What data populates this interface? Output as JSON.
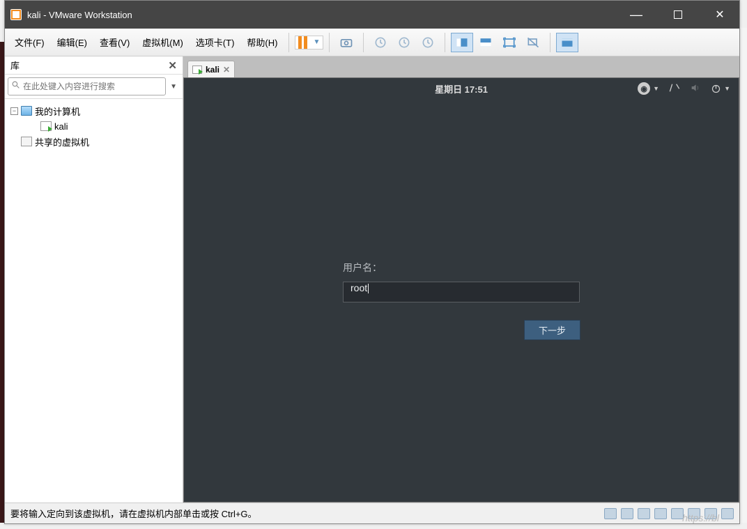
{
  "window": {
    "title": "kali - VMware Workstation"
  },
  "menu": {
    "items": [
      "文件(F)",
      "编辑(E)",
      "查看(V)",
      "虚拟机(M)",
      "选项卡(T)",
      "帮助(H)"
    ]
  },
  "sidebar": {
    "title": "库",
    "search_placeholder": "在此处键入内容进行搜索",
    "tree": {
      "root": "我的计算机",
      "child": "kali",
      "shared": "共享的虚拟机"
    }
  },
  "tab": {
    "label": "kali"
  },
  "vm": {
    "clock": "星期日 17:51",
    "login_label": "用户名：",
    "username_value": "root",
    "next_button": "下一步"
  },
  "statusbar": {
    "message": "要将输入定向到该虚拟机，请在虚拟机内部单击或按 Ctrl+G。"
  },
  "watermark": "https://bl"
}
